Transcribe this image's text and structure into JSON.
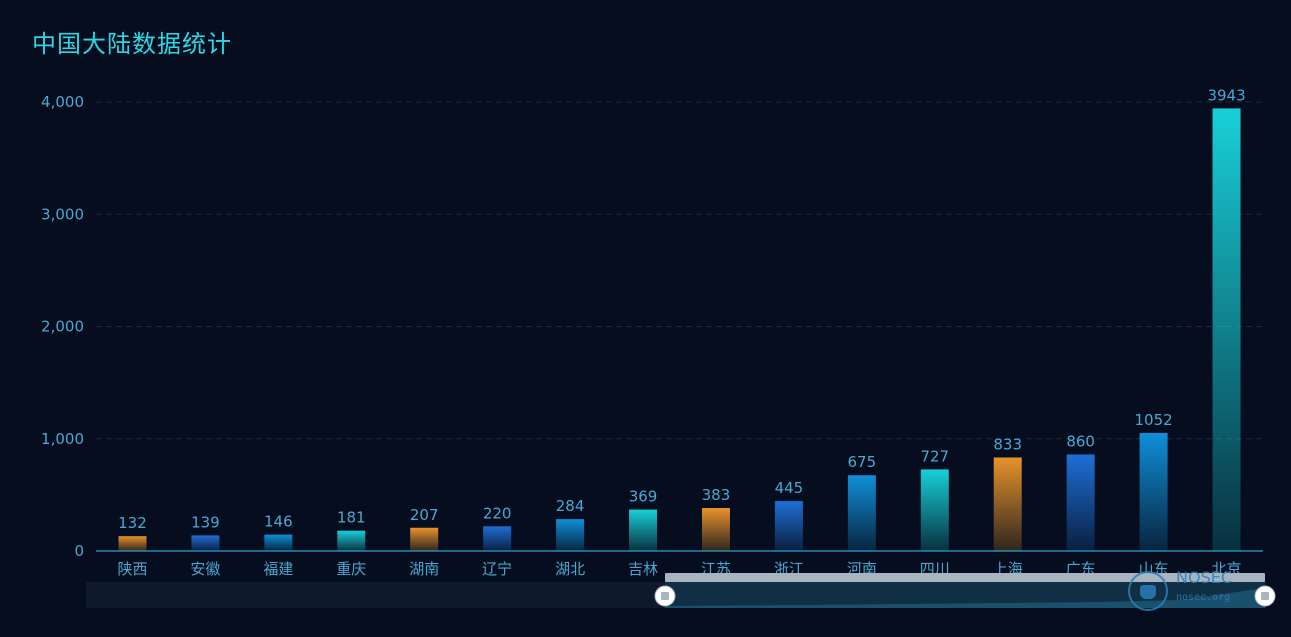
{
  "title": "中国大陆数据统计",
  "watermark": {
    "brand": "NOSEC",
    "sub": "nosec.org"
  },
  "chart_data": {
    "type": "bar",
    "categories": [
      "陕西",
      "安徽",
      "福建",
      "重庆",
      "湖南",
      "辽宁",
      "湖北",
      "吉林",
      "江苏",
      "浙江",
      "河南",
      "四川",
      "上海",
      "广东",
      "山东",
      "北京"
    ],
    "values": [
      132,
      139,
      146,
      181,
      207,
      220,
      284,
      369,
      383,
      445,
      675,
      727,
      833,
      860,
      1052,
      3943
    ],
    "yticks": [
      "0",
      "1,000",
      "2,000",
      "3,000",
      "4,000"
    ],
    "ylim": [
      0,
      4000
    ],
    "grid": true,
    "data_labels": true,
    "colors": [
      "#e8922a",
      "#1e6fd6",
      "#0f8fd8",
      "#18d0d8"
    ]
  }
}
